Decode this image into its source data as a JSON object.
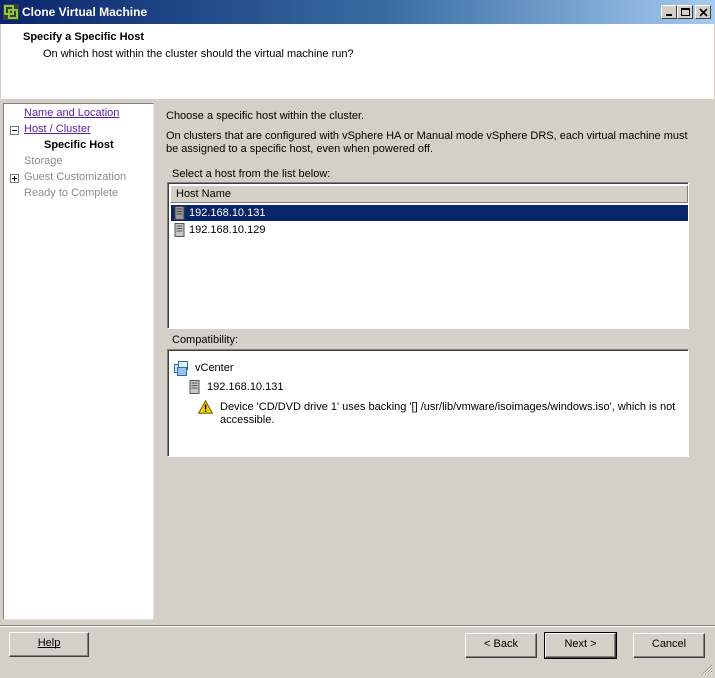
{
  "window": {
    "title": "Clone Virtual Machine"
  },
  "header": {
    "title": "Specify a Specific Host",
    "subtitle": "On which host within the cluster should the virtual machine run?"
  },
  "nav": {
    "items": [
      {
        "label": "Name and Location",
        "state": "link"
      },
      {
        "label": "Host / Cluster",
        "state": "link",
        "expander": "minus"
      },
      {
        "label": "Specific Host",
        "state": "current"
      },
      {
        "label": "Storage",
        "state": "disabled"
      },
      {
        "label": "Guest Customization",
        "state": "disabled",
        "expander": "plus"
      },
      {
        "label": "Ready to Complete",
        "state": "disabled"
      }
    ]
  },
  "main": {
    "intro": "Choose a specific host within the cluster.",
    "description_line1": "On clusters that are configured with vSphere HA or Manual mode vSphere DRS, each virtual machine must",
    "description_line2": "be assigned to a specific host, even when powered off.",
    "list_label": "Select a host from the list below:",
    "column_header": "Host Name",
    "hosts": [
      {
        "name": "192.168.10.131",
        "selected": true
      },
      {
        "name": "192.168.10.129",
        "selected": false
      }
    ],
    "compat_label": "Compatibility:",
    "compat": {
      "root": "vCenter",
      "host": "192.168.10.131",
      "warning_line1": "Device 'CD/DVD drive 1' uses backing '[] /usr/lib/vmware/isoimages/windows.iso', which is not",
      "warning_line2": "accessible."
    }
  },
  "footer": {
    "help_label": "Help",
    "back_label": "< Back",
    "next_label": "Next >",
    "cancel_label": "Cancel"
  },
  "icons": {
    "title": "vmware-logo-icon",
    "host": "server-icon",
    "vcenter": "vcenter-icon",
    "warning": "warning-icon"
  },
  "colors": {
    "title_gradient_start": "#0a246a",
    "selection": "#0a246a",
    "link": "#5a1ea5"
  }
}
